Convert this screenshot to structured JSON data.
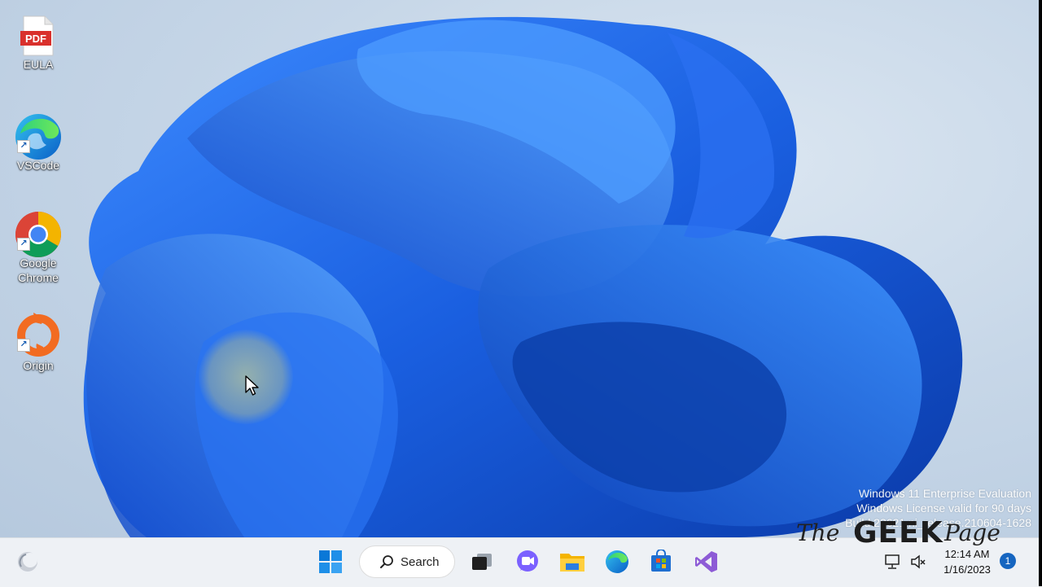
{
  "desktop": {
    "icons": [
      {
        "label": "EULA",
        "icon": "pdf-file-icon",
        "badge": "PDF"
      },
      {
        "label": "VSCode",
        "icon": "edge-icon"
      },
      {
        "label": "Google Chrome",
        "icon": "chrome-icon"
      },
      {
        "label": "Origin",
        "icon": "origin-icon"
      }
    ]
  },
  "watermark": {
    "line1": "Windows 11 Enterprise Evaluation",
    "line2": "Windows License valid for 90 days",
    "line3": "Build 22621.ni_release.210604-1628"
  },
  "brand": {
    "the": "The",
    "geek": "GEEK",
    "page": "Page"
  },
  "taskbar": {
    "search_label": "Search",
    "apps": [
      "start-icon",
      "task-view-icon",
      "teams-chat-icon",
      "file-explorer-icon",
      "edge-icon",
      "store-icon",
      "visual-studio-icon"
    ],
    "tray": {
      "time": "12:14 AM",
      "date": "1/16/2023",
      "notifications": "1"
    }
  },
  "colors": {
    "accent": "#0067c0",
    "wallpaper_blue": "#1a5fe0"
  }
}
